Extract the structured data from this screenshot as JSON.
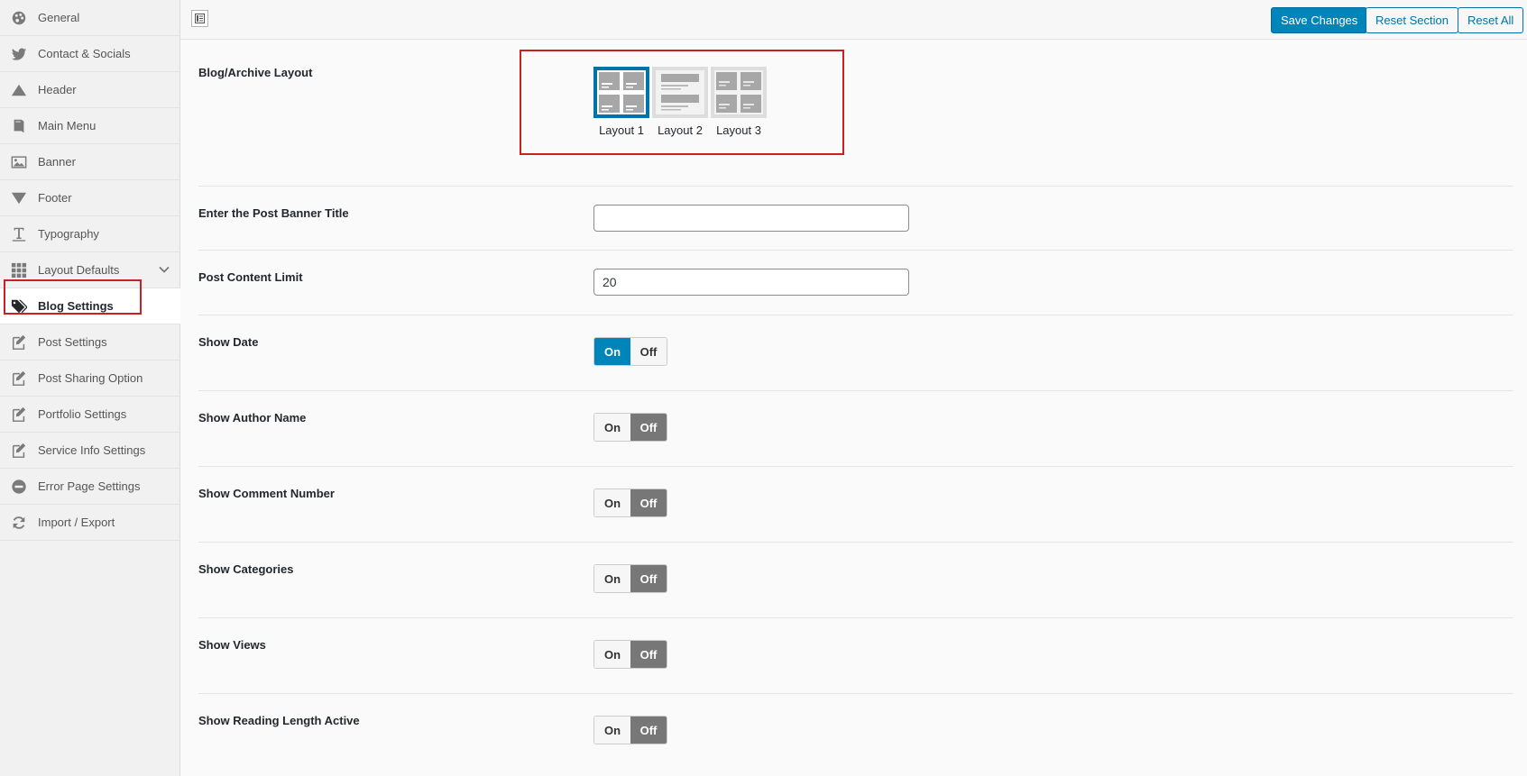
{
  "sidebar": {
    "items": [
      {
        "label": "General",
        "icon": "palette-icon"
      },
      {
        "label": "Contact & Socials",
        "icon": "twitter-icon"
      },
      {
        "label": "Header",
        "icon": "triangle-up-icon"
      },
      {
        "label": "Main Menu",
        "icon": "book-icon"
      },
      {
        "label": "Banner",
        "icon": "image-icon"
      },
      {
        "label": "Footer",
        "icon": "triangle-down-icon"
      },
      {
        "label": "Typography",
        "icon": "text-icon"
      },
      {
        "label": "Layout Defaults",
        "icon": "grid-icon"
      },
      {
        "label": "Blog Settings",
        "icon": "tags-icon"
      },
      {
        "label": "Post Settings",
        "icon": "edit-icon"
      },
      {
        "label": "Post Sharing Option",
        "icon": "edit-icon"
      },
      {
        "label": "Portfolio Settings",
        "icon": "edit-icon"
      },
      {
        "label": "Service Info Settings",
        "icon": "edit-icon"
      },
      {
        "label": "Error Page Settings",
        "icon": "minus-circle-icon"
      },
      {
        "label": "Import / Export",
        "icon": "refresh-icon"
      }
    ],
    "active": "Blog Settings"
  },
  "toolbar": {
    "save_label": "Save Changes",
    "reset_section_label": "Reset Section",
    "reset_all_label": "Reset All"
  },
  "settings": {
    "blog_layout": {
      "label": "Blog/Archive Layout",
      "options": [
        "Layout 1",
        "Layout 2",
        "Layout 3"
      ],
      "selected": "Layout 1"
    },
    "banner_title": {
      "label": "Enter the Post Banner Title",
      "value": "",
      "placeholder": ""
    },
    "content_limit": {
      "label": "Post Content Limit",
      "value": "20"
    },
    "toggles": [
      {
        "label": "Show Date",
        "state": "On"
      },
      {
        "label": "Show Author Name",
        "state": "Off"
      },
      {
        "label": "Show Comment Number",
        "state": "Off"
      },
      {
        "label": "Show Categories",
        "state": "Off"
      },
      {
        "label": "Show Views",
        "state": "Off"
      },
      {
        "label": "Show Reading Length Active",
        "state": "Off"
      }
    ],
    "on_label": "On",
    "off_label": "Off"
  },
  "colors": {
    "primary": "#0085ba",
    "highlight": "#cc1f1f",
    "off": "#777777"
  }
}
